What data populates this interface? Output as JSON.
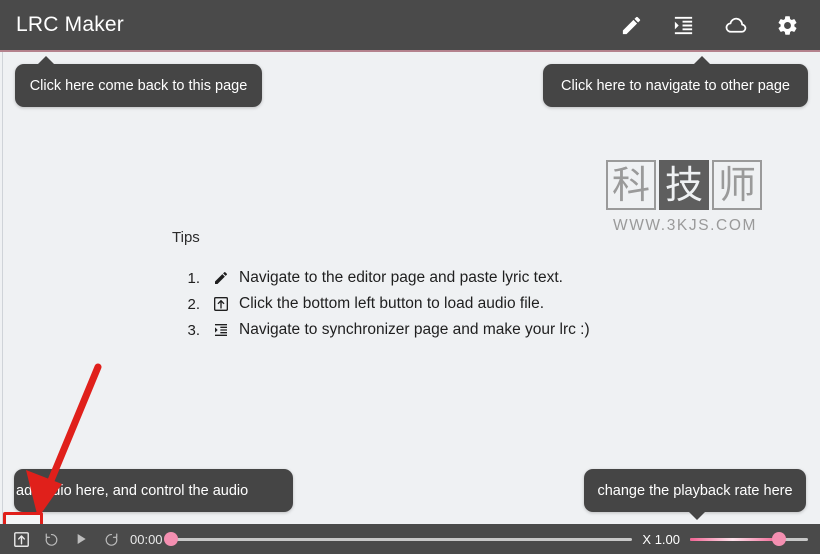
{
  "header": {
    "title": "LRC Maker",
    "icons": [
      {
        "name": "pencil-icon",
        "label": "Editor"
      },
      {
        "name": "format-indent-icon",
        "label": "Synchronizer"
      },
      {
        "name": "cloud-icon",
        "label": "Cloud"
      },
      {
        "name": "gear-icon",
        "label": "Settings"
      }
    ]
  },
  "tooltips": {
    "back": "Click here come back to this page",
    "navigate": "Click here to navigate to other page",
    "audio": "ad audio here, and control the audio",
    "rate": "change the playback rate here"
  },
  "tips": {
    "title": "Tips",
    "items": [
      {
        "num": "1.",
        "icon": "pencil-icon",
        "text": "Navigate to the editor page and paste lyric text."
      },
      {
        "num": "2.",
        "icon": "upload-box-icon",
        "text": "Click the bottom left button to load audio file."
      },
      {
        "num": "3.",
        "icon": "format-indent-icon",
        "text": "Navigate to synchronizer page and make your lrc :)"
      }
    ]
  },
  "watermark": {
    "chars": [
      "科",
      "技",
      "师"
    ],
    "url": "WWW.3KJS.COM"
  },
  "player": {
    "buttons": [
      {
        "name": "load-audio-button",
        "label": "Load audio"
      },
      {
        "name": "rewind-5-button",
        "label": "Rewind 5s"
      },
      {
        "name": "play-button",
        "label": "Play"
      },
      {
        "name": "forward-5-button",
        "label": "Forward 5s"
      }
    ],
    "current_time": "00:00",
    "progress_percent": 0,
    "rate_label": "X 1.00",
    "rate_percent": 75
  },
  "colors": {
    "header_bg": "#4a4a4a",
    "header_underline": "#b4828d",
    "page_bg": "#eff1f3",
    "bubble_bg": "#454545",
    "accent_pink": "#f48fb1",
    "annotation_red": "#e0201b"
  }
}
